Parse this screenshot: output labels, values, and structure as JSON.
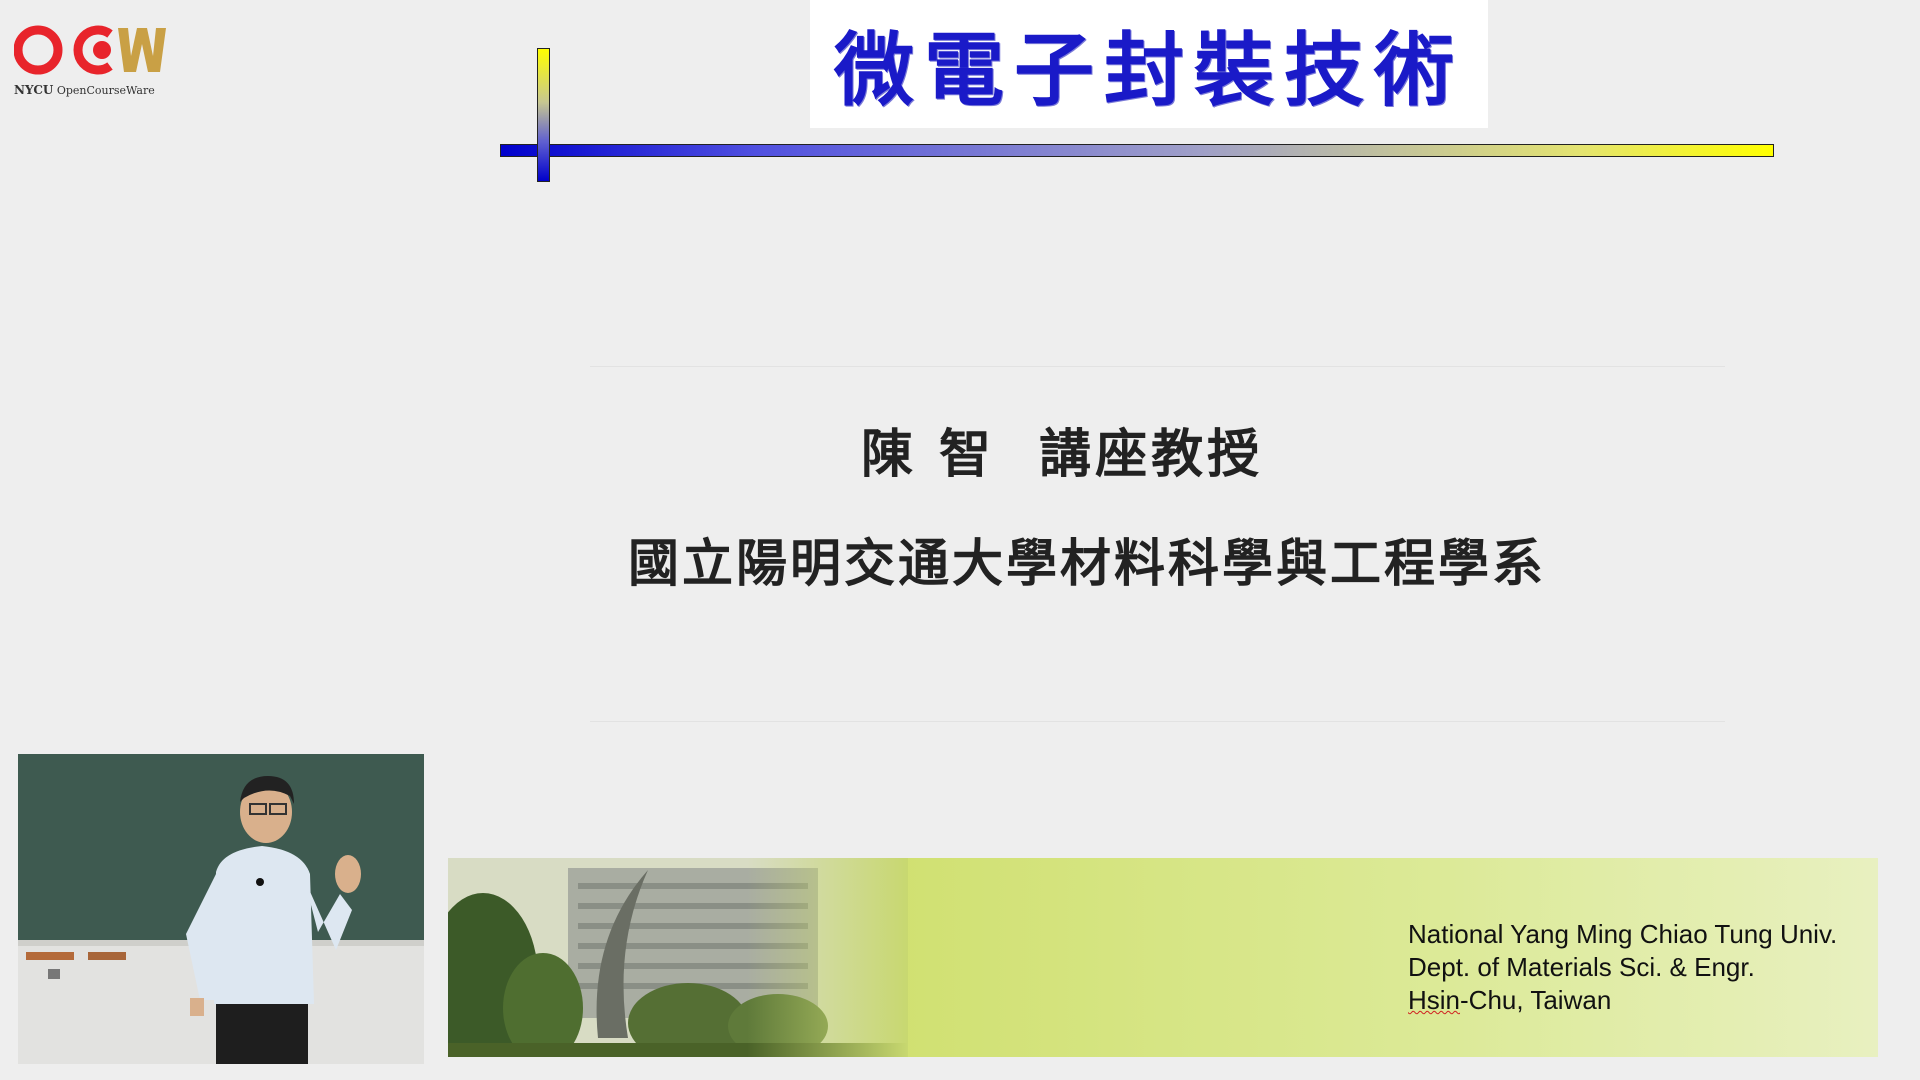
{
  "logo": {
    "org": "NYCU",
    "product": "OpenCourseWare",
    "mark_letters": "OCW",
    "colors": {
      "red": "#e8242b",
      "gold": "#c9a045"
    }
  },
  "slide": {
    "title": "微電子封裝技術",
    "professor": "陳 智  講座教授",
    "department": "國立陽明交通大學材料科學與工程學系"
  },
  "banner": {
    "line1": "National Yang Ming Chiao Tung Univ.",
    "line2": "Dept. of Materials Sci. & Engr.",
    "line3_part1": "Hsin",
    "line3_part2": "-Chu, Taiwan"
  },
  "colors": {
    "title_blue": "#1a1ac8",
    "bar_blue": "#0000cc",
    "bar_yellow": "#ffff00",
    "banner_green": "#d0e070",
    "background": "#eeeeee"
  }
}
